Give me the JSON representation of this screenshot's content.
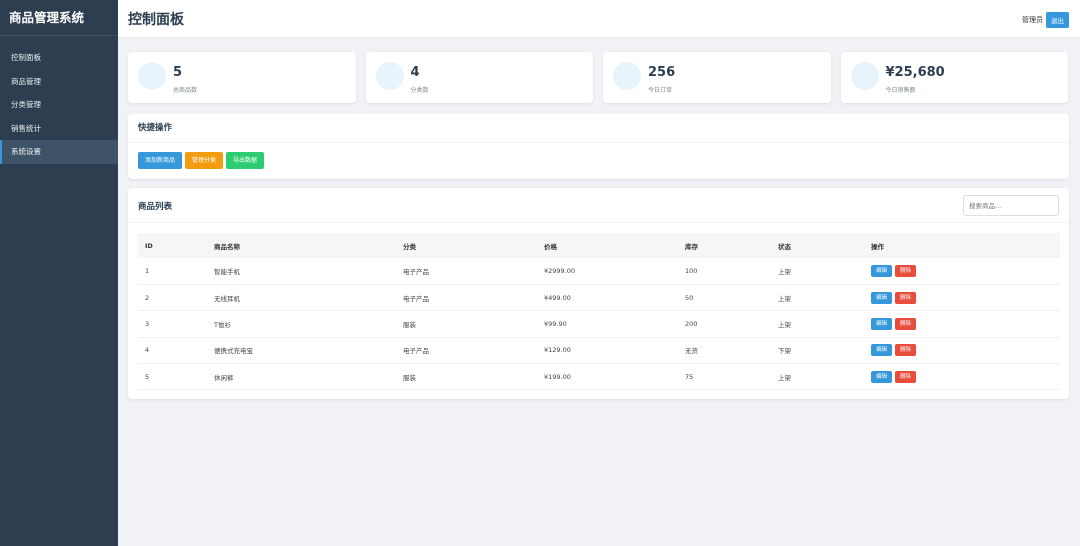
{
  "sidebar": {
    "title": "商品管理系统",
    "items": [
      {
        "label": "控制面板"
      },
      {
        "label": "商品管理"
      },
      {
        "label": "分类管理"
      },
      {
        "label": "销售统计"
      },
      {
        "label": "系统设置"
      }
    ],
    "active_index": 4
  },
  "header": {
    "title": "控制面板",
    "user": "管理员",
    "logout_label": "退出"
  },
  "stats": [
    {
      "value": "5",
      "label": "总商品数"
    },
    {
      "value": "4",
      "label": "分类数"
    },
    {
      "value": "256",
      "label": "今日订单"
    },
    {
      "value": "¥25,680",
      "label": "今日销售额"
    }
  ],
  "quick_actions": {
    "title": "快捷操作",
    "buttons": [
      {
        "label": "添加新商品",
        "color": "#3498db"
      },
      {
        "label": "管理分类",
        "color": "#f39c12"
      },
      {
        "label": "导出数据",
        "color": "#2ecc71"
      }
    ]
  },
  "product_list": {
    "title": "商品列表",
    "search_placeholder": "搜索商品...",
    "columns": [
      "ID",
      "商品名称",
      "分类",
      "价格",
      "库存",
      "状态",
      "操作"
    ],
    "rows": [
      {
        "id": "1",
        "name": "智能手机",
        "category": "电子产品",
        "price": "¥2999.00",
        "stock": "100",
        "status": "上架"
      },
      {
        "id": "2",
        "name": "无线耳机",
        "category": "电子产品",
        "price": "¥499.00",
        "stock": "50",
        "status": "上架"
      },
      {
        "id": "3",
        "name": "T恤衫",
        "category": "服装",
        "price": "¥99.90",
        "stock": "200",
        "status": "上架"
      },
      {
        "id": "4",
        "name": "便携式充电宝",
        "category": "电子产品",
        "price": "¥129.00",
        "stock": "无货",
        "status": "下架"
      },
      {
        "id": "5",
        "name": "休闲裤",
        "category": "服装",
        "price": "¥199.00",
        "stock": "75",
        "status": "上架"
      }
    ],
    "edit_label": "编辑",
    "delete_label": "删除"
  },
  "colors": {
    "sidebar_bg": "#2c3e50",
    "primary": "#3498db",
    "danger": "#e74c3c",
    "warning": "#f39c12",
    "success": "#2ecc71"
  }
}
